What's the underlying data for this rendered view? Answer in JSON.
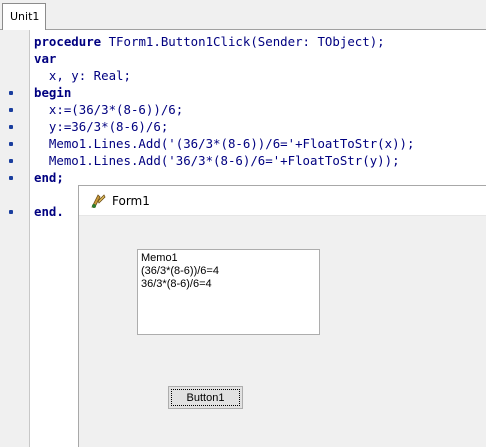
{
  "editor": {
    "tab_label": "Unit1",
    "code_lines": [
      {
        "kw": "procedure",
        "rest": " TForm1.Button1Click(Sender: TObject);"
      },
      {
        "kw": "var",
        "rest": ""
      },
      {
        "kw": "",
        "rest": "  x, y: Real;"
      },
      {
        "kw": "begin",
        "rest": ""
      },
      {
        "kw": "",
        "rest": "  x:=(36/3*(8-6))/6;"
      },
      {
        "kw": "",
        "rest": "  y:=36/3*(8-6)/6;"
      },
      {
        "kw": "",
        "rest": "  Memo1.Lines.Add('(36/3*(8-6))/6='+FloatToStr(x));"
      },
      {
        "kw": "",
        "rest": "  Memo1.Lines.Add('36/3*(8-6)/6='+FloatToStr(y));"
      },
      {
        "kw": "end;",
        "rest": ""
      },
      {
        "kw": "",
        "rest": ""
      },
      {
        "kw": "end.",
        "rest": ""
      }
    ],
    "breakpoint_dot_lines": [
      3,
      4,
      5,
      6,
      7,
      8,
      10
    ]
  },
  "form": {
    "title": "Form1",
    "memo_lines": [
      "Memo1",
      "(36/3*(8-6))/6=4",
      "36/3*(8-6)/6=4"
    ],
    "button_label": "Button1"
  },
  "colors": {
    "code_text": "#000080",
    "breakpoint_dot": "#1a3e9e",
    "gutter": "#f0f0f0",
    "form_background": "#f0f0f0"
  },
  "icons": {
    "app_icon": "delphi-app-icon"
  }
}
